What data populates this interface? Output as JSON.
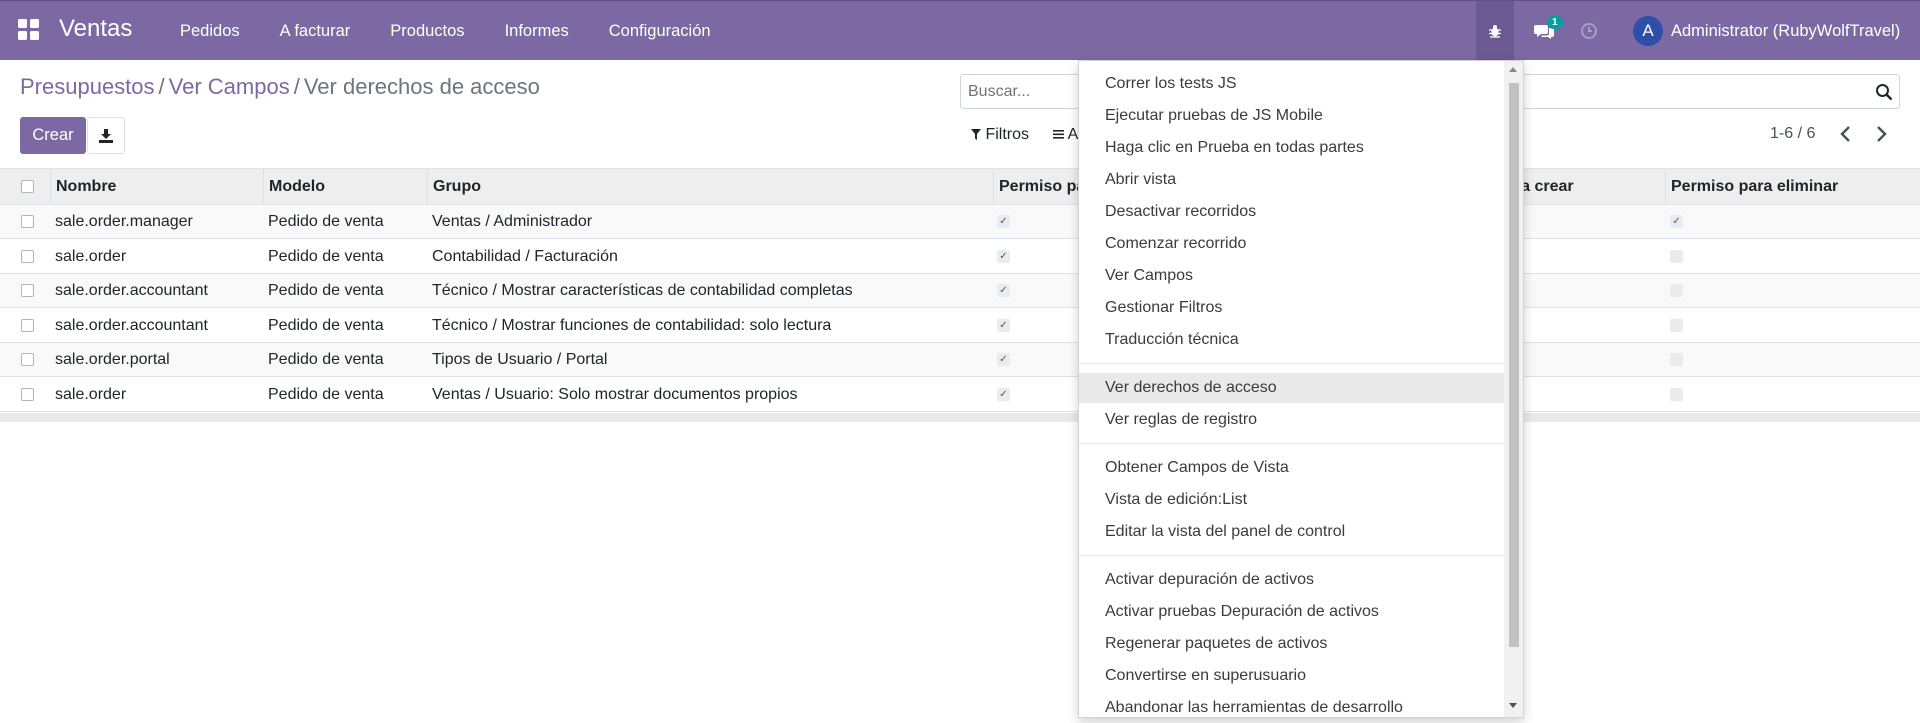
{
  "navbar": {
    "app_name": "Ventas",
    "menu": [
      "Pedidos",
      "A facturar",
      "Productos",
      "Informes",
      "Configuración"
    ],
    "chat_count": "1",
    "user_initial": "A",
    "user_name": "Administrator (RubyWolfTravel)",
    "bg_color": "#7c69a4"
  },
  "breadcrumb": {
    "items": [
      "Presupuestos",
      "Ver Campos"
    ],
    "separator": "/",
    "current": "Ver derechos de acceso"
  },
  "buttons": {
    "create": "Crear",
    "download_icon": "download-icon"
  },
  "search": {
    "placeholder": "Buscar..."
  },
  "filters": {
    "filters_label": "Filtros",
    "groupby_label": "A"
  },
  "pager": {
    "value": "1-6 / 6"
  },
  "table": {
    "headers": [
      "Nombre",
      "Modelo",
      "Grupo",
      "Permiso pa",
      "ara crear",
      "Permiso para eliminar"
    ],
    "rows": [
      {
        "name": "sale.order.manager",
        "model": "Pedido de venta",
        "group": "Ventas / Administrador",
        "perm_read": true,
        "perm_unlink": true
      },
      {
        "name": "sale.order",
        "model": "Pedido de venta",
        "group": "Contabilidad / Facturación",
        "perm_read": true,
        "perm_unlink": false
      },
      {
        "name": "sale.order.accountant",
        "model": "Pedido de venta",
        "group": "Técnico / Mostrar características de contabilidad completas",
        "perm_read": true,
        "perm_unlink": false
      },
      {
        "name": "sale.order.accountant",
        "model": "Pedido de venta",
        "group": "Técnico / Mostrar funciones de contabilidad: solo lectura",
        "perm_read": true,
        "perm_unlink": false
      },
      {
        "name": "sale.order.portal",
        "model": "Pedido de venta",
        "group": "Tipos de Usuario / Portal",
        "perm_read": true,
        "perm_unlink": false
      },
      {
        "name": "sale.order",
        "model": "Pedido de venta",
        "group": "Ventas / Usuario: Solo mostrar documentos propios",
        "perm_read": true,
        "perm_unlink": false
      }
    ]
  },
  "debug_menu": {
    "groups": [
      [
        "Correr los tests JS",
        "Ejecutar pruebas de JS Mobile",
        "Haga clic en Prueba en todas partes",
        "Abrir vista",
        "Desactivar recorridos",
        "Comenzar recorrido",
        "Ver Campos",
        "Gestionar Filtros",
        "Traducción técnica"
      ],
      [
        "Ver derechos de acceso",
        "Ver reglas de registro"
      ],
      [
        "Obtener Campos de Vista",
        "Vista de edición:List",
        "Editar la vista del panel de control"
      ],
      [
        "Activar depuración de activos",
        "Activar pruebas Depuración de activos",
        "Regenerar paquetes de activos",
        "Convertirse en superusuario",
        "Abandonar las herramientas de desarrollo"
      ]
    ],
    "active_item": "Ver derechos de acceso"
  }
}
